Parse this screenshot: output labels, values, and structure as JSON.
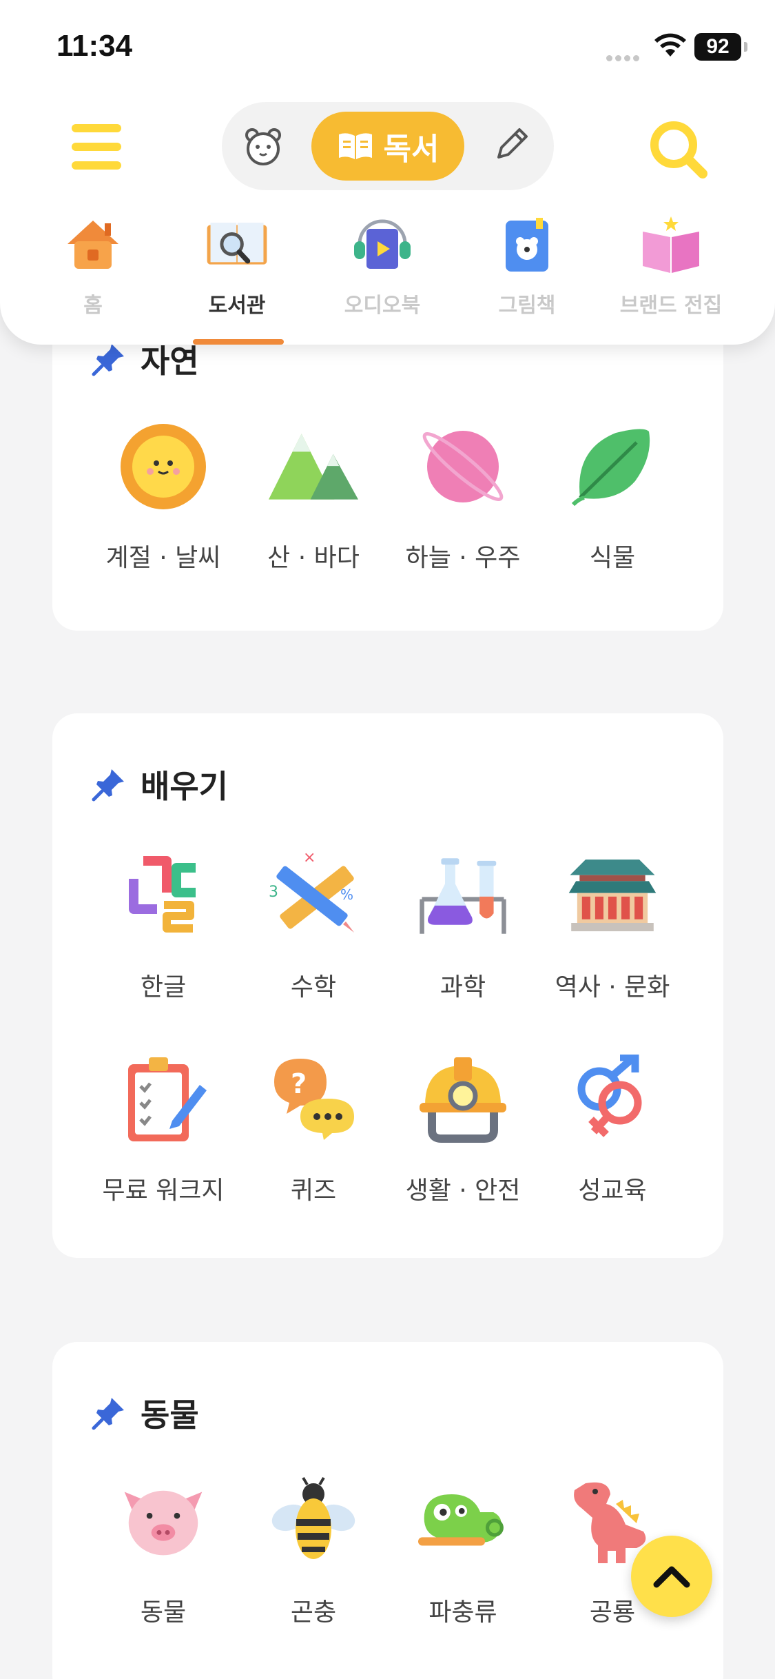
{
  "status_bar": {
    "time": "11:34",
    "battery": "92"
  },
  "header": {
    "mode_switch": {
      "active_label": "독서"
    },
    "tabs": [
      {
        "label": "홈",
        "icon": "house-icon"
      },
      {
        "label": "도서관",
        "icon": "book-magnifier-icon",
        "active": true
      },
      {
        "label": "오디오북",
        "icon": "headphones-book-icon"
      },
      {
        "label": "그림책",
        "icon": "bear-book-icon"
      },
      {
        "label": "브랜드 전집",
        "icon": "pink-book-icon"
      }
    ]
  },
  "sections": [
    {
      "title": "자연",
      "items": [
        {
          "label": "계절 · 날씨",
          "icon": "sun-icon"
        },
        {
          "label": "산 · 바다",
          "icon": "mountain-icon"
        },
        {
          "label": "하늘 · 우주",
          "icon": "planet-icon"
        },
        {
          "label": "식물",
          "icon": "leaf-icon"
        }
      ]
    },
    {
      "title": "배우기",
      "items": [
        {
          "label": "한글",
          "icon": "hangul-icon"
        },
        {
          "label": "수학",
          "icon": "ruler-pencil-icon"
        },
        {
          "label": "과학",
          "icon": "flask-icon"
        },
        {
          "label": "역사 · 문화",
          "icon": "palace-icon"
        },
        {
          "label": "무료 워크지",
          "icon": "clipboard-icon"
        },
        {
          "label": "퀴즈",
          "icon": "quiz-bubble-icon"
        },
        {
          "label": "생활 · 안전",
          "icon": "helmet-icon"
        },
        {
          "label": "성교육",
          "icon": "gender-icon"
        }
      ]
    },
    {
      "title": "동물",
      "items": [
        {
          "label": "동물",
          "icon": "pig-icon"
        },
        {
          "label": "곤충",
          "icon": "bee-icon"
        },
        {
          "label": "파충류",
          "icon": "chameleon-icon"
        },
        {
          "label": "공룡",
          "icon": "dinosaur-icon"
        }
      ]
    }
  ],
  "colors": {
    "accent": "#f7bb32",
    "hamburger": "#ffd93a",
    "indicator": "#f08a3a",
    "fab": "#ffe04a"
  }
}
